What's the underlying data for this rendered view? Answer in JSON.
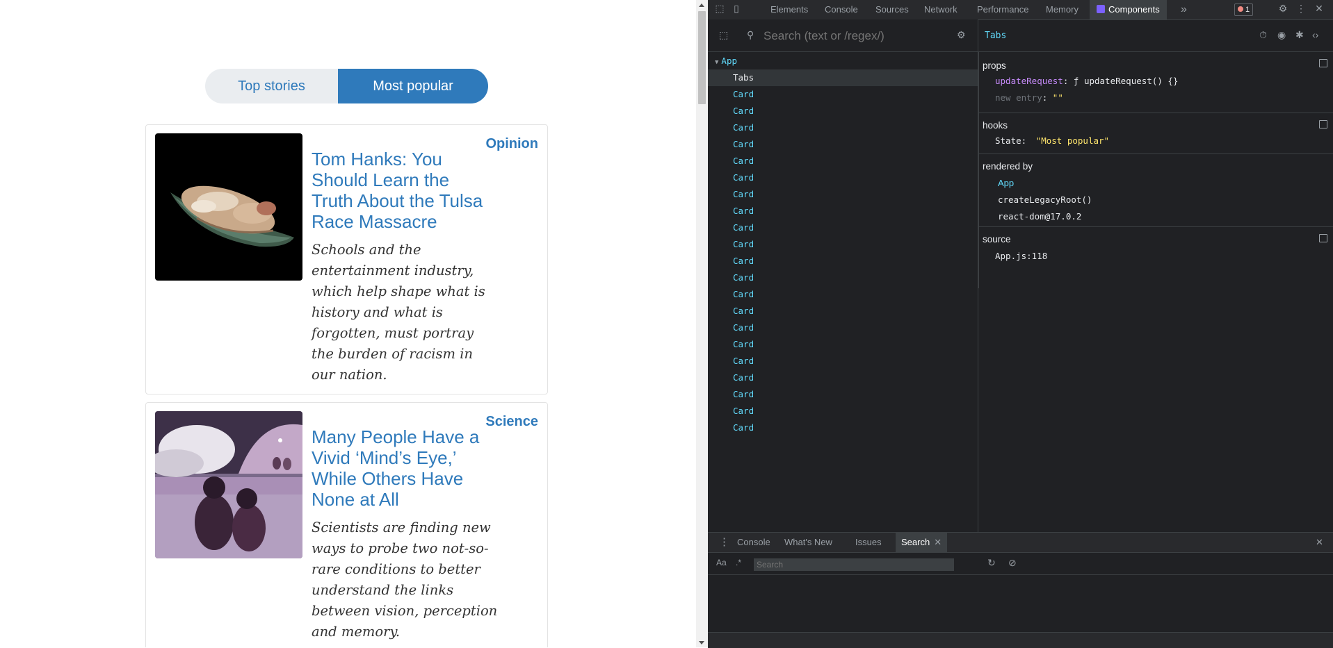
{
  "page": {
    "tabs": [
      {
        "label": "Top stories",
        "active": false
      },
      {
        "label": "Most popular",
        "active": true
      }
    ],
    "cards": [
      {
        "category": "Opinion",
        "title": "Tom Hanks: You Should Learn the Truth About the Tulsa Race Massacre",
        "summary": "Schools and the entertainment industry, which help shape what is history and what is forgotten, must portray the burden of racism in our nation."
      },
      {
        "category": "Science",
        "title": "Many People Have a Vivid ‘Mind’s Eye,’ While Others Have None at All",
        "summary": "Scientists are finding new ways to probe two not-so-rare conditions to better understand the links between vision, perception and memory."
      }
    ]
  },
  "devtools": {
    "tabs": [
      "Elements",
      "Console",
      "Sources",
      "Network",
      "Performance",
      "Memory",
      "Components"
    ],
    "selected_tab": "Components",
    "more_tabs": "»",
    "error_count": "1",
    "search_placeholder": "Search (text or /regex/)",
    "tree": {
      "root": "App",
      "selected": "Tabs",
      "children": [
        "Tabs",
        "Card",
        "Card",
        "Card",
        "Card",
        "Card",
        "Card",
        "Card",
        "Card",
        "Card",
        "Card",
        "Card",
        "Card",
        "Card",
        "Card",
        "Card",
        "Card",
        "Card",
        "Card",
        "Card",
        "Card",
        "Card"
      ]
    },
    "inspector": {
      "component": "Tabs",
      "props_label": "props",
      "prop_key": "updateRequest",
      "prop_value": "ƒ updateRequest() {}",
      "new_entry_label": "new entry",
      "new_entry_value": "\"\"",
      "hooks_label": "hooks",
      "hook_key": "State:",
      "hook_value": "\"Most popular\"",
      "rendered_by_label": "rendered by",
      "rendered_by": [
        "App",
        "createLegacyRoot()",
        "react-dom@17.0.2"
      ],
      "source_label": "source",
      "source_value": "App.js:118"
    },
    "drawer": {
      "tabs": [
        "Console",
        "What's New",
        "Issues",
        "Search"
      ],
      "selected_tab": "Search",
      "case_label": "Aa",
      "regex_label": ".*",
      "search_placeholder": "Search"
    },
    "colors": {
      "accent": "#2f7abb",
      "react_blue": "#61dafb",
      "panel_bg": "#202124"
    }
  }
}
